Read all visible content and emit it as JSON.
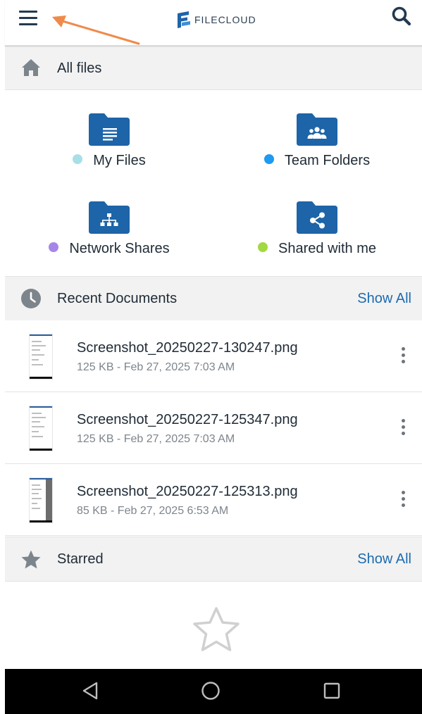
{
  "app": {
    "title": "FILECLOUD",
    "logo_icon": "filecloud-logo-icon",
    "menu_icon": "hamburger-menu-icon",
    "search_icon": "search-icon"
  },
  "all_files": {
    "title": "All files",
    "icon": "home-icon"
  },
  "folders": [
    {
      "label": "My Files",
      "icon": "folder-document-icon",
      "dot_color": "#a8dfe7"
    },
    {
      "label": "Team Folders",
      "icon": "folder-team-icon",
      "dot_color": "#1e9af0"
    },
    {
      "label": "Network Shares",
      "icon": "folder-network-icon",
      "dot_color": "#a685e8"
    },
    {
      "label": "Shared with me",
      "icon": "folder-share-icon",
      "dot_color": "#a2d940"
    }
  ],
  "recent": {
    "title": "Recent Documents",
    "show_all": "Show All",
    "icon": "clock-icon",
    "items": [
      {
        "name": "Screenshot_20250227-130247.png",
        "meta": "125 KB - Feb 27, 2025 7:03 AM"
      },
      {
        "name": "Screenshot_20250227-125347.png",
        "meta": "125 KB - Feb 27, 2025 7:03 AM"
      },
      {
        "name": "Screenshot_20250227-125313.png",
        "meta": "85 KB - Feb 27, 2025 6:53 AM"
      }
    ]
  },
  "starred": {
    "title": "Starred",
    "show_all": "Show All",
    "icon": "star-icon",
    "empty_icon": "star-outline-icon"
  },
  "colors": {
    "folder_blue": "#1d64a8",
    "link_blue": "#1c6bb0",
    "annotation_arrow": "#f08a4b"
  },
  "system_nav": {
    "back": "back-triangle-icon",
    "home": "home-circle-icon",
    "recents": "recents-square-icon"
  }
}
